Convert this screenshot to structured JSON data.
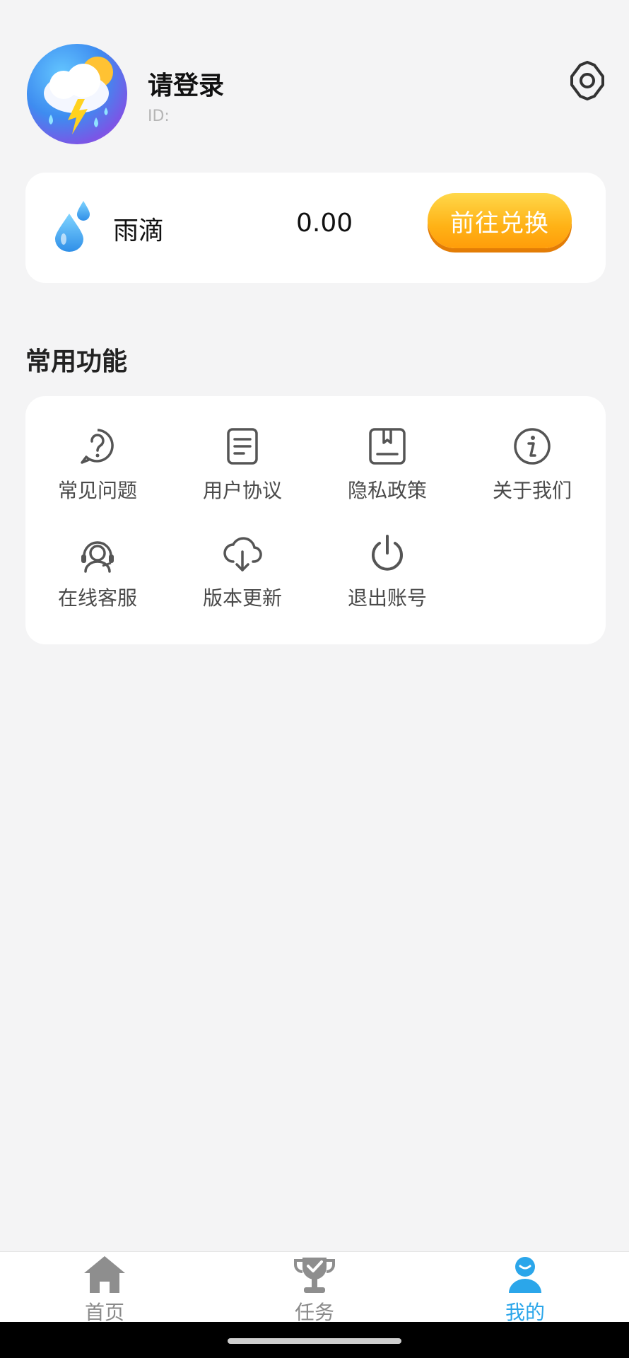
{
  "header": {
    "title": "请登录",
    "subtitle": "ID:"
  },
  "raindrop": {
    "label": "雨滴",
    "value": "0.00",
    "button_label": "前往兑换"
  },
  "functions": {
    "section_title": "常用功能",
    "items": [
      {
        "label": "常见问题",
        "icon": "question-icon"
      },
      {
        "label": "用户协议",
        "icon": "document-icon"
      },
      {
        "label": "隐私政策",
        "icon": "bookmark-doc-icon"
      },
      {
        "label": "关于我们",
        "icon": "info-icon"
      },
      {
        "label": "在线客服",
        "icon": "headset-icon"
      },
      {
        "label": "版本更新",
        "icon": "cloud-download-icon"
      },
      {
        "label": "退出账号",
        "icon": "power-icon"
      }
    ]
  },
  "bottom_nav": {
    "items": [
      {
        "label": "首页",
        "icon": "home-icon"
      },
      {
        "label": "任务",
        "icon": "trophy-icon"
      },
      {
        "label": "我的",
        "icon": "user-icon",
        "active": true
      }
    ]
  },
  "colors": {
    "accent": "#2ba6ea",
    "button": "#ffb216",
    "background": "#f4f4f5"
  }
}
